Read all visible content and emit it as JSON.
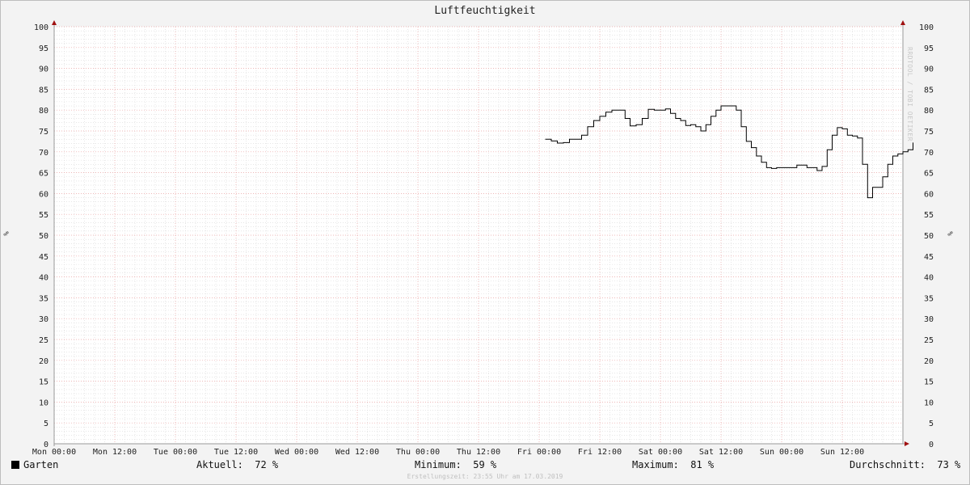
{
  "chart_data": {
    "type": "line",
    "title": "Luftfeuchtigkeit",
    "ylabel": "%",
    "ylim": [
      0,
      100
    ],
    "y_ticks": [
      "0",
      "5",
      "10",
      "15",
      "20",
      "25",
      "30",
      "35",
      "40",
      "45",
      "50",
      "55",
      "60",
      "65",
      "70",
      "75",
      "80",
      "85",
      "90",
      "95",
      "100"
    ],
    "x_ticks": [
      "Mon 00:00",
      "Mon 12:00",
      "Tue 00:00",
      "Tue 12:00",
      "Wed 00:00",
      "Wed 12:00",
      "Thu 00:00",
      "Thu 12:00",
      "Fri 00:00",
      "Fri 12:00",
      "Sat 00:00",
      "Sat 12:00",
      "Sun 00:00",
      "Sun 12:00"
    ],
    "x_unit": "hours since Mon 00:00",
    "xlim": [
      0,
      168
    ],
    "grid": true,
    "series": [
      {
        "name": "Garten",
        "color": "#000000",
        "step": true,
        "points": [
          [
            97.2,
            73
          ],
          [
            98.4,
            72.6
          ],
          [
            99.6,
            72.1
          ],
          [
            100.8,
            72.2
          ],
          [
            102,
            73
          ],
          [
            103.2,
            73
          ],
          [
            104.4,
            74
          ],
          [
            105.6,
            76
          ],
          [
            106.8,
            77.5
          ],
          [
            108,
            78.5
          ],
          [
            109.2,
            79.5
          ],
          [
            110.4,
            80
          ],
          [
            112,
            80
          ],
          [
            113,
            78
          ],
          [
            114,
            76.2
          ],
          [
            115.2,
            76.5
          ],
          [
            116.4,
            78
          ],
          [
            117.6,
            80.2
          ],
          [
            118.8,
            80
          ],
          [
            120,
            80
          ],
          [
            121,
            80.3
          ],
          [
            122,
            79.2
          ],
          [
            123,
            78
          ],
          [
            124,
            77.5
          ],
          [
            125,
            76.3
          ],
          [
            126,
            76.5
          ],
          [
            127,
            76
          ],
          [
            128,
            75
          ],
          [
            129,
            76.5
          ],
          [
            130,
            78.5
          ],
          [
            131,
            80
          ],
          [
            132,
            81
          ],
          [
            133,
            81
          ],
          [
            134,
            81
          ],
          [
            135,
            80
          ],
          [
            136,
            76
          ],
          [
            137,
            72.5
          ],
          [
            138,
            71
          ],
          [
            139,
            69
          ],
          [
            140,
            67.5
          ],
          [
            141,
            66.2
          ],
          [
            142,
            66
          ],
          [
            143,
            66.2
          ],
          [
            144,
            66.2
          ],
          [
            145,
            66.2
          ],
          [
            146,
            66.2
          ],
          [
            147,
            66.8
          ],
          [
            148,
            66.8
          ],
          [
            149,
            66.2
          ],
          [
            150,
            66.2
          ],
          [
            151,
            65.5
          ],
          [
            152,
            66.5
          ],
          [
            153,
            70.5
          ],
          [
            154,
            74
          ],
          [
            155,
            75.8
          ],
          [
            156,
            75.5
          ],
          [
            157,
            74
          ],
          [
            158,
            73.8
          ],
          [
            159,
            73.3
          ],
          [
            160,
            67
          ],
          [
            161,
            59
          ],
          [
            162,
            61.5
          ],
          [
            163,
            61.5
          ],
          [
            164,
            64
          ],
          [
            165,
            67
          ],
          [
            166,
            69
          ],
          [
            167,
            69.5
          ],
          [
            168,
            70
          ],
          [
            169,
            70.5
          ],
          [
            170,
            72.2
          ]
        ]
      }
    ]
  },
  "side_text": "RRDTOOL / TOBI OETIKER",
  "legend": {
    "series_name": "Garten",
    "current_label": "Aktuell:",
    "current_value": "72 %",
    "min_label": "Minimum:",
    "min_value": "59 %",
    "max_label": "Maximum:",
    "max_value": "81 %",
    "avg_label": "Durchschnitt:",
    "avg_value": "73 %"
  },
  "footer": "Erstellungszeit: 23:55 Uhr am 17.03.2019",
  "colors": {
    "major_grid": "#e8a0a0",
    "minor_grid": "#d7d7d7",
    "axis": "#999999",
    "arrow": "#a01010",
    "line": "#000000"
  }
}
